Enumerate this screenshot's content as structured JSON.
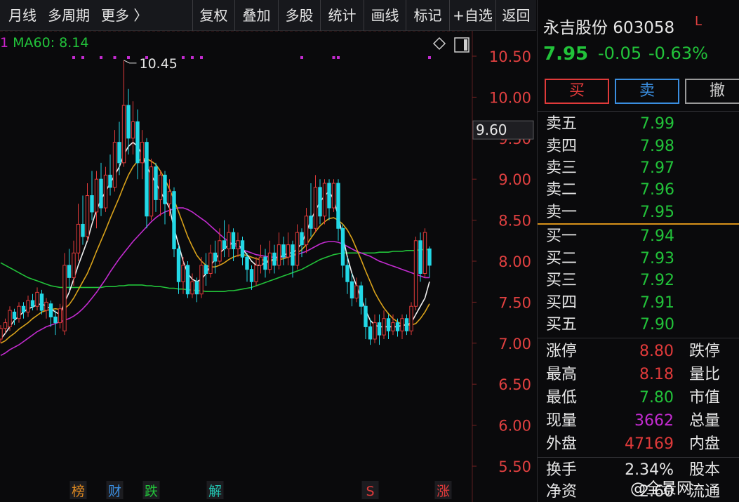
{
  "toolbar": {
    "left_items": [
      "月线",
      "多周期",
      "更多 〉"
    ],
    "buttons": [
      "复权",
      "叠加",
      "多股",
      "统计",
      "画线",
      "标记",
      "+自选",
      "返回"
    ]
  },
  "legend": {
    "prefix": "1",
    "ma60_label": "MA60: 8.14"
  },
  "colors": {
    "up": "#e03a3a",
    "down": "#22d8e6",
    "ma5": "#f0f0f0",
    "ma10": "#d9a21a",
    "ma20": "#c32bd0",
    "ma60": "#22c33a",
    "axis_text": "#e04040",
    "grid": "#3a1a1a"
  },
  "chart_data": {
    "type": "candlestick",
    "y_axis_ticks": [
      "10.50",
      "10.00",
      "9.50",
      "9.00",
      "8.50",
      "8.00",
      "7.50",
      "7.00",
      "6.50",
      "6.00",
      "5.50"
    ],
    "ylim": [
      5.3,
      10.8
    ],
    "crosshair_value": "9.60",
    "max_annotation": "10.45",
    "candles": [
      {
        "o": 7.05,
        "c": 7.18,
        "h": 7.22,
        "l": 7.0
      },
      {
        "o": 7.18,
        "c": 7.25,
        "h": 7.3,
        "l": 7.12
      },
      {
        "o": 7.2,
        "c": 7.4,
        "h": 7.45,
        "l": 7.15
      },
      {
        "o": 7.38,
        "c": 7.3,
        "h": 7.42,
        "l": 7.22
      },
      {
        "o": 7.3,
        "c": 7.45,
        "h": 7.5,
        "l": 7.25
      },
      {
        "o": 7.45,
        "c": 7.38,
        "h": 7.5,
        "l": 7.3
      },
      {
        "o": 7.38,
        "c": 7.52,
        "h": 7.58,
        "l": 7.32
      },
      {
        "o": 7.52,
        "c": 7.45,
        "h": 7.6,
        "l": 7.4
      },
      {
        "o": 7.45,
        "c": 7.62,
        "h": 7.68,
        "l": 7.4
      },
      {
        "o": 7.6,
        "c": 7.4,
        "h": 7.65,
        "l": 7.35
      },
      {
        "o": 7.4,
        "c": 7.5,
        "h": 7.55,
        "l": 7.3
      },
      {
        "o": 7.48,
        "c": 7.32,
        "h": 7.52,
        "l": 7.2
      },
      {
        "o": 7.32,
        "c": 7.25,
        "h": 7.4,
        "l": 7.1
      },
      {
        "o": 7.25,
        "c": 7.42,
        "h": 7.48,
        "l": 7.18
      },
      {
        "o": 7.15,
        "c": 7.95,
        "h": 8.1,
        "l": 7.1
      },
      {
        "o": 7.95,
        "c": 7.8,
        "h": 8.15,
        "l": 7.65
      },
      {
        "o": 7.8,
        "c": 8.1,
        "h": 8.25,
        "l": 7.7
      },
      {
        "o": 8.1,
        "c": 8.45,
        "h": 8.7,
        "l": 8.0
      },
      {
        "o": 8.45,
        "c": 8.3,
        "h": 8.8,
        "l": 8.2
      },
      {
        "o": 8.3,
        "c": 8.8,
        "h": 8.95,
        "l": 8.25
      },
      {
        "o": 8.8,
        "c": 8.6,
        "h": 9.1,
        "l": 8.5
      },
      {
        "o": 8.6,
        "c": 9.0,
        "h": 9.1,
        "l": 8.4
      },
      {
        "o": 9.0,
        "c": 8.65,
        "h": 9.2,
        "l": 8.55
      },
      {
        "o": 8.65,
        "c": 9.05,
        "h": 9.15,
        "l": 8.6
      },
      {
        "o": 9.05,
        "c": 8.9,
        "h": 9.3,
        "l": 8.8
      },
      {
        "o": 8.9,
        "c": 9.45,
        "h": 9.6,
        "l": 8.85
      },
      {
        "o": 9.45,
        "c": 9.2,
        "h": 9.7,
        "l": 9.05
      },
      {
        "o": 9.2,
        "c": 9.9,
        "h": 10.45,
        "l": 9.15
      },
      {
        "o": 9.9,
        "c": 9.5,
        "h": 10.1,
        "l": 9.3
      },
      {
        "o": 9.5,
        "c": 9.7,
        "h": 9.95,
        "l": 9.3
      },
      {
        "o": 9.7,
        "c": 9.2,
        "h": 9.85,
        "l": 9.0
      },
      {
        "o": 9.2,
        "c": 9.45,
        "h": 9.6,
        "l": 9.0
      },
      {
        "o": 9.45,
        "c": 8.55,
        "h": 9.5,
        "l": 8.4
      },
      {
        "o": 8.55,
        "c": 9.15,
        "h": 9.25,
        "l": 8.5
      },
      {
        "o": 9.15,
        "c": 8.75,
        "h": 9.2,
        "l": 8.6
      },
      {
        "o": 8.75,
        "c": 9.05,
        "h": 9.1,
        "l": 8.55
      },
      {
        "o": 9.05,
        "c": 8.7,
        "h": 9.1,
        "l": 8.45
      },
      {
        "o": 8.7,
        "c": 8.85,
        "h": 9.0,
        "l": 8.55
      },
      {
        "o": 8.85,
        "c": 8.15,
        "h": 8.9,
        "l": 8.05
      },
      {
        "o": 8.15,
        "c": 7.75,
        "h": 8.2,
        "l": 7.6
      },
      {
        "o": 7.75,
        "c": 7.95,
        "h": 8.05,
        "l": 7.6
      },
      {
        "o": 7.95,
        "c": 7.6,
        "h": 8.0,
        "l": 7.55
      },
      {
        "o": 7.6,
        "c": 7.75,
        "h": 7.85,
        "l": 7.55
      },
      {
        "o": 7.75,
        "c": 7.6,
        "h": 7.8,
        "l": 7.5
      },
      {
        "o": 7.6,
        "c": 7.95,
        "h": 8.05,
        "l": 7.55
      },
      {
        "o": 7.95,
        "c": 7.85,
        "h": 8.1,
        "l": 7.7
      },
      {
        "o": 7.85,
        "c": 8.1,
        "h": 8.2,
        "l": 7.8
      },
      {
        "o": 8.1,
        "c": 8.0,
        "h": 8.25,
        "l": 7.85
      },
      {
        "o": 8.0,
        "c": 8.25,
        "h": 8.4,
        "l": 7.95
      },
      {
        "o": 8.25,
        "c": 8.15,
        "h": 8.5,
        "l": 8.05
      },
      {
        "o": 8.15,
        "c": 8.35,
        "h": 8.45,
        "l": 8.05
      },
      {
        "o": 8.35,
        "c": 8.15,
        "h": 8.4,
        "l": 8.0
      },
      {
        "o": 8.15,
        "c": 8.25,
        "h": 8.35,
        "l": 8.05
      },
      {
        "o": 8.25,
        "c": 8.05,
        "h": 8.3,
        "l": 7.95
      },
      {
        "o": 8.05,
        "c": 7.9,
        "h": 8.1,
        "l": 7.75
      },
      {
        "o": 7.9,
        "c": 7.75,
        "h": 7.95,
        "l": 7.65
      },
      {
        "o": 7.75,
        "c": 7.95,
        "h": 8.05,
        "l": 7.7
      },
      {
        "o": 7.95,
        "c": 8.05,
        "h": 8.2,
        "l": 7.85
      },
      {
        "o": 8.05,
        "c": 7.9,
        "h": 8.15,
        "l": 7.8
      },
      {
        "o": 7.9,
        "c": 8.1,
        "h": 8.25,
        "l": 7.85
      },
      {
        "o": 8.1,
        "c": 7.95,
        "h": 8.2,
        "l": 7.85
      },
      {
        "o": 7.95,
        "c": 8.2,
        "h": 8.35,
        "l": 7.9
      },
      {
        "o": 8.2,
        "c": 8.05,
        "h": 8.3,
        "l": 7.95
      },
      {
        "o": 8.05,
        "c": 8.2,
        "h": 8.35,
        "l": 7.95
      },
      {
        "o": 8.2,
        "c": 7.95,
        "h": 8.25,
        "l": 7.8
      },
      {
        "o": 7.95,
        "c": 8.35,
        "h": 8.45,
        "l": 7.9
      },
      {
        "o": 8.35,
        "c": 8.2,
        "h": 8.4,
        "l": 8.05
      },
      {
        "o": 8.2,
        "c": 8.55,
        "h": 8.65,
        "l": 8.1
      },
      {
        "o": 8.55,
        "c": 8.4,
        "h": 8.95,
        "l": 8.3
      },
      {
        "o": 8.4,
        "c": 8.9,
        "h": 9.05,
        "l": 8.35
      },
      {
        "o": 8.9,
        "c": 8.55,
        "h": 9.0,
        "l": 8.45
      },
      {
        "o": 8.55,
        "c": 8.95,
        "h": 9.0,
        "l": 8.45
      },
      {
        "o": 8.95,
        "c": 8.65,
        "h": 9.0,
        "l": 8.5
      },
      {
        "o": 8.65,
        "c": 8.95,
        "h": 9.0,
        "l": 8.6
      },
      {
        "o": 8.95,
        "c": 8.4,
        "h": 9.0,
        "l": 8.25
      },
      {
        "o": 8.4,
        "c": 7.95,
        "h": 8.45,
        "l": 7.8
      },
      {
        "o": 7.95,
        "c": 7.75,
        "h": 8.05,
        "l": 7.6
      },
      {
        "o": 7.75,
        "c": 7.55,
        "h": 7.85,
        "l": 7.45
      },
      {
        "o": 7.55,
        "c": 7.7,
        "h": 7.8,
        "l": 7.5
      },
      {
        "o": 7.7,
        "c": 7.45,
        "h": 7.75,
        "l": 7.35
      },
      {
        "o": 7.45,
        "c": 7.2,
        "h": 7.55,
        "l": 7.05
      },
      {
        "o": 7.2,
        "c": 7.05,
        "h": 7.3,
        "l": 6.98
      },
      {
        "o": 7.05,
        "c": 7.25,
        "h": 7.35,
        "l": 7.0
      },
      {
        "o": 7.25,
        "c": 7.1,
        "h": 7.35,
        "l": 6.98
      },
      {
        "o": 7.1,
        "c": 7.3,
        "h": 7.4,
        "l": 7.05
      },
      {
        "o": 7.3,
        "c": 7.15,
        "h": 7.35,
        "l": 7.05
      },
      {
        "o": 7.15,
        "c": 7.25,
        "h": 7.35,
        "l": 7.1
      },
      {
        "o": 7.25,
        "c": 7.15,
        "h": 7.3,
        "l": 7.08
      },
      {
        "o": 7.15,
        "c": 7.3,
        "h": 7.35,
        "l": 7.05
      },
      {
        "o": 7.3,
        "c": 7.15,
        "h": 7.35,
        "l": 7.1
      },
      {
        "o": 7.15,
        "c": 7.45,
        "h": 7.5,
        "l": 7.1
      },
      {
        "o": 7.45,
        "c": 8.25,
        "h": 8.3,
        "l": 7.4
      },
      {
        "o": 8.25,
        "c": 7.85,
        "h": 8.35,
        "l": 7.75
      },
      {
        "o": 7.85,
        "c": 8.35,
        "h": 8.4,
        "l": 7.8
      },
      {
        "o": 8.15,
        "c": 7.95,
        "h": 8.18,
        "l": 7.8
      }
    ],
    "ma5": [
      7.05,
      7.12,
      7.2,
      7.28,
      7.33,
      7.38,
      7.42,
      7.44,
      7.47,
      7.48,
      7.45,
      7.42,
      7.38,
      7.35,
      7.5,
      7.62,
      7.78,
      7.95,
      8.1,
      8.25,
      8.45,
      8.62,
      8.75,
      8.85,
      8.95,
      9.05,
      9.15,
      9.3,
      9.4,
      9.45,
      9.4,
      9.3,
      9.15,
      9.05,
      8.95,
      8.85,
      8.75,
      8.65,
      8.4,
      8.2,
      8.0,
      7.85,
      7.78,
      7.75,
      7.78,
      7.85,
      7.95,
      8.02,
      8.1,
      8.15,
      8.2,
      8.22,
      8.2,
      8.15,
      8.08,
      8.0,
      7.95,
      7.95,
      7.98,
      8.0,
      8.03,
      8.05,
      8.07,
      8.1,
      8.1,
      8.15,
      8.22,
      8.35,
      8.5,
      8.62,
      8.72,
      8.8,
      8.85,
      8.75,
      8.55,
      8.3,
      8.05,
      7.85,
      7.7,
      7.55,
      7.4,
      7.28,
      7.22,
      7.2,
      7.2,
      7.2,
      7.2,
      7.2,
      7.22,
      7.22,
      7.25,
      7.35,
      7.45,
      7.55,
      7.75
    ],
    "ma10": [
      7.0,
      7.03,
      7.08,
      7.12,
      7.17,
      7.21,
      7.25,
      7.3,
      7.34,
      7.38,
      7.4,
      7.41,
      7.42,
      7.41,
      7.42,
      7.47,
      7.55,
      7.65,
      7.75,
      7.85,
      7.98,
      8.12,
      8.25,
      8.38,
      8.52,
      8.65,
      8.78,
      8.92,
      9.05,
      9.15,
      9.22,
      9.25,
      9.25,
      9.22,
      9.18,
      9.1,
      9.0,
      8.88,
      8.75,
      8.6,
      8.45,
      8.3,
      8.18,
      8.07,
      8.0,
      7.95,
      7.93,
      7.93,
      7.95,
      7.98,
      8.02,
      8.05,
      8.07,
      8.08,
      8.07,
      8.05,
      8.03,
      8.02,
      8.01,
      8.0,
      8.01,
      8.02,
      8.03,
      8.05,
      8.07,
      8.1,
      8.14,
      8.2,
      8.28,
      8.36,
      8.43,
      8.48,
      8.52,
      8.53,
      8.5,
      8.45,
      8.38,
      8.28,
      8.15,
      8.02,
      7.88,
      7.75,
      7.62,
      7.52,
      7.43,
      7.36,
      7.3,
      7.26,
      7.23,
      7.22,
      7.22,
      7.24,
      7.3,
      7.38,
      7.48
    ],
    "ma20": [
      6.85,
      6.88,
      6.92,
      6.95,
      6.98,
      7.02,
      7.06,
      7.1,
      7.14,
      7.17,
      7.2,
      7.22,
      7.24,
      7.26,
      7.28,
      7.3,
      7.33,
      7.37,
      7.42,
      7.48,
      7.55,
      7.62,
      7.7,
      7.78,
      7.87,
      7.95,
      8.03,
      8.1,
      8.17,
      8.24,
      8.3,
      8.36,
      8.42,
      8.48,
      8.53,
      8.57,
      8.6,
      8.62,
      8.64,
      8.65,
      8.65,
      8.63,
      8.6,
      8.56,
      8.52,
      8.48,
      8.43,
      8.38,
      8.33,
      8.28,
      8.24,
      8.2,
      8.17,
      8.14,
      8.12,
      8.1,
      8.08,
      8.07,
      8.06,
      8.05,
      8.05,
      8.05,
      8.05,
      8.06,
      8.07,
      8.08,
      8.1,
      8.12,
      8.15,
      8.18,
      8.21,
      8.23,
      8.24,
      8.24,
      8.23,
      8.21,
      8.18,
      8.15,
      8.12,
      8.1,
      8.08,
      8.06,
      8.03,
      8.0,
      7.98,
      7.96,
      7.94,
      7.92,
      7.9,
      7.88,
      7.86,
      7.84,
      7.82,
      7.8,
      7.8
    ],
    "ma60": [
      7.98,
      7.95,
      7.92,
      7.89,
      7.86,
      7.83,
      7.8,
      7.78,
      7.76,
      7.74,
      7.72,
      7.7,
      7.69,
      7.68,
      7.68,
      7.68,
      7.68,
      7.68,
      7.68,
      7.68,
      7.68,
      7.68,
      7.68,
      7.69,
      7.69,
      7.69,
      7.7,
      7.7,
      7.71,
      7.71,
      7.71,
      7.71,
      7.7,
      7.7,
      7.69,
      7.69,
      7.68,
      7.67,
      7.67,
      7.66,
      7.66,
      7.65,
      7.65,
      7.64,
      7.64,
      7.63,
      7.63,
      7.63,
      7.63,
      7.63,
      7.64,
      7.64,
      7.65,
      7.66,
      7.67,
      7.68,
      7.7,
      7.72,
      7.74,
      7.76,
      7.78,
      7.8,
      7.82,
      7.84,
      7.86,
      7.88,
      7.9,
      7.93,
      7.96,
      7.99,
      8.02,
      8.04,
      8.06,
      8.08,
      8.09,
      8.1,
      8.1,
      8.1,
      8.1,
      8.1,
      8.1,
      8.1,
      8.1,
      8.11,
      8.11,
      8.11,
      8.12,
      8.12,
      8.12,
      8.13,
      8.13,
      8.13,
      8.14,
      8.14,
      8.14
    ],
    "markers": [
      "榜",
      "财",
      "跌",
      "解",
      "S",
      "涨"
    ],
    "marker_colors": [
      "#e08a20",
      "#3a8ee0",
      "#22c33a",
      "#22c3b0",
      "#e03a3a",
      "#e03a3a"
    ],
    "marker_index": [
      17,
      25,
      33,
      47,
      81,
      97
    ]
  },
  "panel": {
    "name_code": "永吉股份 603058",
    "flag": "L",
    "price": "7.95",
    "change": "-0.05",
    "change_pct": "-0.63%",
    "buttons": {
      "buy": "买",
      "sell": "卖",
      "cancel": "撤"
    },
    "sell_orders": [
      {
        "label": "卖五",
        "price": "7.99"
      },
      {
        "label": "卖四",
        "price": "7.98"
      },
      {
        "label": "卖三",
        "price": "7.97"
      },
      {
        "label": "卖二",
        "price": "7.96"
      },
      {
        "label": "卖一",
        "price": "7.95"
      }
    ],
    "buy_orders": [
      {
        "label": "买一",
        "price": "7.94"
      },
      {
        "label": "买二",
        "price": "7.93"
      },
      {
        "label": "买三",
        "price": "7.92"
      },
      {
        "label": "买四",
        "price": "7.91"
      },
      {
        "label": "买五",
        "price": "7.90"
      }
    ],
    "stats": [
      {
        "label": "涨停",
        "value": "8.80",
        "color": "#e03a3a",
        "label2": "跌停"
      },
      {
        "label": "最高",
        "value": "8.18",
        "color": "#e03a3a",
        "label2": "量比"
      },
      {
        "label": "最低",
        "value": "7.80",
        "color": "#22c33a",
        "label2": "市值"
      },
      {
        "label": "现量",
        "value": "3662",
        "color": "#c32bd0",
        "label2": "总量"
      },
      {
        "label": "外盘",
        "value": "47169",
        "color": "#e03a3a",
        "label2": "内盘"
      },
      {
        "label": "换手",
        "value": "2.34%",
        "color": "#e6e6e6",
        "label2": "股本"
      },
      {
        "label": "净资",
        "value": "2.60",
        "color": "#e6e6e6",
        "label2": "流通"
      }
    ]
  },
  "watermark": "@全景网"
}
